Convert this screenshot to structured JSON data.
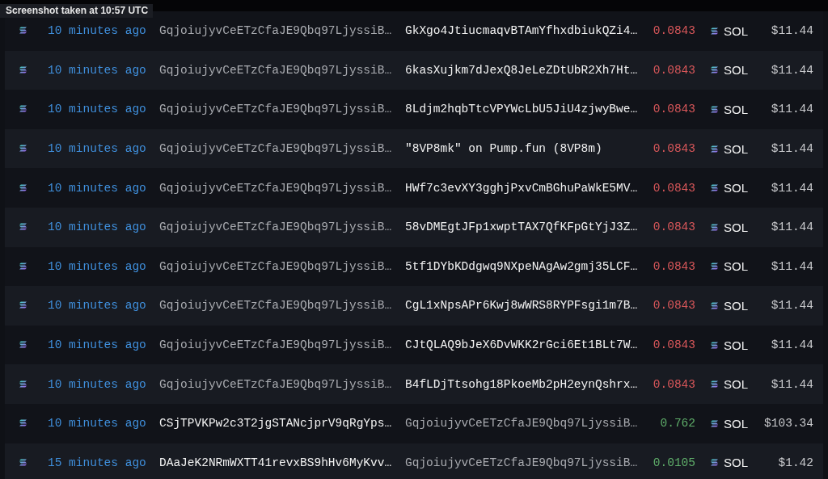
{
  "caption": "Screenshot taken at 10:57 UTC",
  "rows": [
    {
      "time": "10 minutes ago",
      "from": "GqjoiujyvCeETzCfaJE9Qbq97LjyssiB…",
      "from_muted": true,
      "to": "GkXgo4JtiucmaqvBTAmYfhxdbiukQZi4…",
      "to_muted": false,
      "amount": "0.0843",
      "color": "#d9575a",
      "token": "SOL",
      "usd": "$11.44"
    },
    {
      "time": "10 minutes ago",
      "from": "GqjoiujyvCeETzCfaJE9Qbq97LjyssiB…",
      "from_muted": true,
      "to": "6kasXujkm7dJexQ8JeLeZDtUbR2Xh7Ht…",
      "to_muted": false,
      "amount": "0.0843",
      "color": "#d9575a",
      "token": "SOL",
      "usd": "$11.44"
    },
    {
      "time": "10 minutes ago",
      "from": "GqjoiujyvCeETzCfaJE9Qbq97LjyssiB…",
      "from_muted": true,
      "to": "8Ldjm2hqbTtcVPYWcLbU5JiU4zjwyBwe…",
      "to_muted": false,
      "amount": "0.0843",
      "color": "#d9575a",
      "token": "SOL",
      "usd": "$11.44"
    },
    {
      "time": "10 minutes ago",
      "from": "GqjoiujyvCeETzCfaJE9Qbq97LjyssiB…",
      "from_muted": true,
      "to": "\"8VP8mk\" on Pump.fun (8VP8m)",
      "to_muted": false,
      "amount": "0.0843",
      "color": "#d9575a",
      "token": "SOL",
      "usd": "$11.44"
    },
    {
      "time": "10 minutes ago",
      "from": "GqjoiujyvCeETzCfaJE9Qbq97LjyssiB…",
      "from_muted": true,
      "to": "HWf7c3evXY3gghjPxvCmBGhuPaWkE5MV…",
      "to_muted": false,
      "amount": "0.0843",
      "color": "#d9575a",
      "token": "SOL",
      "usd": "$11.44"
    },
    {
      "time": "10 minutes ago",
      "from": "GqjoiujyvCeETzCfaJE9Qbq97LjyssiB…",
      "from_muted": true,
      "to": "58vDMEgtJFp1xwptTAX7QfKFpGtYjJ3Z…",
      "to_muted": false,
      "amount": "0.0843",
      "color": "#d9575a",
      "token": "SOL",
      "usd": "$11.44"
    },
    {
      "time": "10 minutes ago",
      "from": "GqjoiujyvCeETzCfaJE9Qbq97LjyssiB…",
      "from_muted": true,
      "to": "5tf1DYbKDdgwq9NXpeNAgAw2gmj35LCF…",
      "to_muted": false,
      "amount": "0.0843",
      "color": "#d9575a",
      "token": "SOL",
      "usd": "$11.44"
    },
    {
      "time": "10 minutes ago",
      "from": "GqjoiujyvCeETzCfaJE9Qbq97LjyssiB…",
      "from_muted": true,
      "to": "CgL1xNpsAPr6Kwj8wWRS8RYPFsgi1m7B…",
      "to_muted": false,
      "amount": "0.0843",
      "color": "#d9575a",
      "token": "SOL",
      "usd": "$11.44"
    },
    {
      "time": "10 minutes ago",
      "from": "GqjoiujyvCeETzCfaJE9Qbq97LjyssiB…",
      "from_muted": true,
      "to": "CJtQLAQ9bJeX6DvWKK2rGci6Et1BLt7W…",
      "to_muted": false,
      "amount": "0.0843",
      "color": "#d9575a",
      "token": "SOL",
      "usd": "$11.44"
    },
    {
      "time": "10 minutes ago",
      "from": "GqjoiujyvCeETzCfaJE9Qbq97LjyssiB…",
      "from_muted": true,
      "to": "B4fLDjTtsohg18PkoeMb2pH2eynQshrx…",
      "to_muted": false,
      "amount": "0.0843",
      "color": "#d9575a",
      "token": "SOL",
      "usd": "$11.44"
    },
    {
      "time": "10 minutes ago",
      "from": "CSjTPVKPw2c3T2jgSTANcjprV9qRgYps…",
      "from_muted": false,
      "to": "GqjoiujyvCeETzCfaJE9Qbq97LjyssiB…",
      "to_muted": true,
      "amount": "0.762",
      "color": "#5fae6a",
      "token": "SOL",
      "usd": "$103.34"
    },
    {
      "time": "15 minutes ago",
      "from": "DAaJeK2NRmWXTT41revxBS9hHv6MyKvv…",
      "from_muted": false,
      "to": "GqjoiujyvCeETzCfaJE9Qbq97LjyssiB…",
      "to_muted": true,
      "amount": "0.0105",
      "color": "#5fae6a",
      "token": "SOL",
      "usd": "$1.42"
    }
  ]
}
